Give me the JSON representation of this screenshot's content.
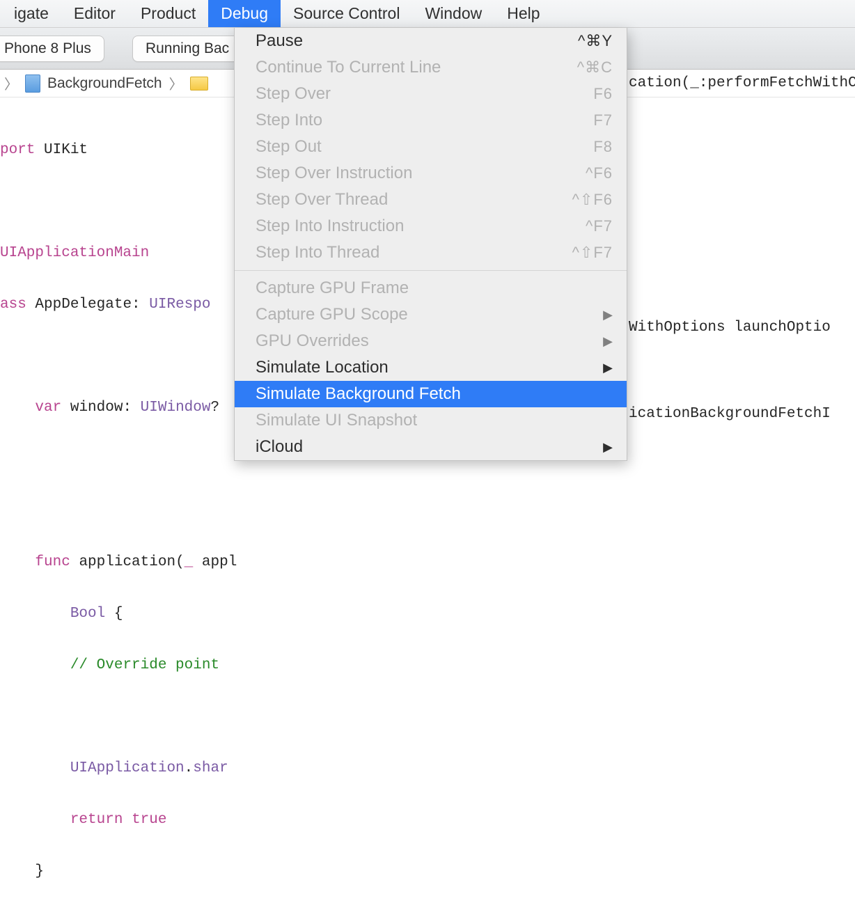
{
  "menubar": {
    "items": [
      "igate",
      "Editor",
      "Product",
      "Debug",
      "Source Control",
      "Window",
      "Help"
    ],
    "active_index": 3
  },
  "toolbar": {
    "device": "Phone 8 Plus",
    "status": "Running Bac"
  },
  "breadcrumb": {
    "project": "BackgroundFetch",
    "right_text": "cation(_:performFetchWithCom"
  },
  "dropdown": {
    "groups": [
      [
        {
          "label": "Pause",
          "shortcut": "^⌘Y",
          "disabled": false,
          "submenu": false
        },
        {
          "label": "Continue To Current Line",
          "shortcut": "^⌘C",
          "disabled": true,
          "submenu": false
        },
        {
          "label": "Step Over",
          "shortcut": "F6",
          "disabled": true,
          "submenu": false
        },
        {
          "label": "Step Into",
          "shortcut": "F7",
          "disabled": true,
          "submenu": false
        },
        {
          "label": "Step Out",
          "shortcut": "F8",
          "disabled": true,
          "submenu": false
        },
        {
          "label": "Step Over Instruction",
          "shortcut": "^F6",
          "disabled": true,
          "submenu": false
        },
        {
          "label": "Step Over Thread",
          "shortcut": "^⇧F6",
          "disabled": true,
          "submenu": false
        },
        {
          "label": "Step Into Instruction",
          "shortcut": "^F7",
          "disabled": true,
          "submenu": false
        },
        {
          "label": "Step Into Thread",
          "shortcut": "^⇧F7",
          "disabled": true,
          "submenu": false
        }
      ],
      [
        {
          "label": "Capture GPU Frame",
          "shortcut": "",
          "disabled": true,
          "submenu": false
        },
        {
          "label": "Capture GPU Scope",
          "shortcut": "",
          "disabled": true,
          "submenu": true
        },
        {
          "label": "GPU Overrides",
          "shortcut": "",
          "disabled": true,
          "submenu": true
        },
        {
          "label": "Simulate Location",
          "shortcut": "",
          "disabled": false,
          "submenu": true
        },
        {
          "label": "Simulate Background Fetch",
          "shortcut": "",
          "disabled": false,
          "submenu": false,
          "highlighted": true
        },
        {
          "label": "Simulate UI Snapshot",
          "shortcut": "",
          "disabled": true,
          "submenu": false
        },
        {
          "label": "iCloud",
          "shortcut": "",
          "disabled": false,
          "submenu": true
        }
      ]
    ]
  },
  "code": {
    "l1_a": "port ",
    "l1_b": "UIKit",
    "l2_a": "UIApplicationMain",
    "l3_a": "ass ",
    "l3_b": "AppDelegate",
    "l3_c": ": ",
    "l3_d": "UIRespo",
    "l4_a": "    ",
    "l4_b": "var",
    "l4_c": " window: ",
    "l4_d": "UIWindow",
    "l4_e": "?",
    "l5_a": "    ",
    "l5_b": "func",
    "l5_c": " application(",
    "l5_d": "_",
    "l5_e": " appl",
    "l5_r": "WithOptions launchOptio",
    "l6_a": "        ",
    "l6_b": "Bool",
    "l6_c": " {",
    "l7_a": "        ",
    "l7_b": "// Override point ",
    "l8_a": "        ",
    "l8_b": "UIApplication",
    "l8_c": ".",
    "l8_d": "shar",
    "l8_r": "icationBackgroundFetchI",
    "l9_a": "        ",
    "l9_b": "return",
    "l9_c": " ",
    "l9_d": "true",
    "l10_a": "    }"
  }
}
